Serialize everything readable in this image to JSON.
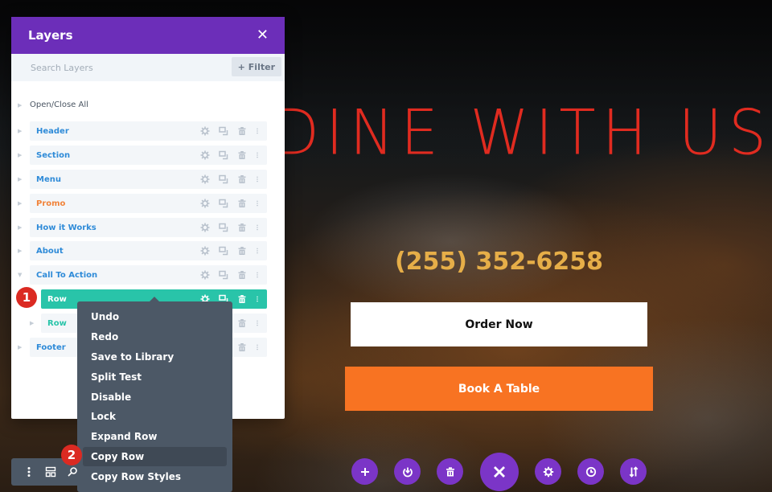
{
  "layers_panel": {
    "title": "Layers",
    "search_placeholder": "Search Layers",
    "filter_label": "Filter",
    "open_close_all": "Open/Close All",
    "items": [
      {
        "label": "Header",
        "color": "#2f8bd8",
        "expanded": false
      },
      {
        "label": "Section",
        "color": "#2f8bd8",
        "expanded": false
      },
      {
        "label": "Menu",
        "color": "#2f8bd8",
        "expanded": false
      },
      {
        "label": "Promo",
        "color": "#f1833a",
        "expanded": false
      },
      {
        "label": "How it Works",
        "color": "#2f8bd8",
        "expanded": false
      },
      {
        "label": "About",
        "color": "#2f8bd8",
        "expanded": false
      },
      {
        "label": "Call To Action",
        "color": "#2f8bd8",
        "expanded": true
      },
      {
        "label": "Row",
        "color": "#29c4a9",
        "active": true
      },
      {
        "label": "Row",
        "color": "#29c4a9",
        "expanded": false
      },
      {
        "label": "Footer",
        "color": "#2f8bd8",
        "expanded": false
      }
    ]
  },
  "context_menu": {
    "items": [
      {
        "label": "Undo"
      },
      {
        "label": "Redo"
      },
      {
        "label": "Save to Library"
      },
      {
        "label": "Split Test"
      },
      {
        "label": "Disable"
      },
      {
        "label": "Lock"
      },
      {
        "label": "Expand Row"
      },
      {
        "label": "Copy Row",
        "hovered": true
      },
      {
        "label": "Copy Row Styles"
      }
    ]
  },
  "badges": {
    "step1": "1",
    "step2": "2"
  },
  "hero": {
    "title": "DINE WITH US",
    "phone": "(255) 352-6258",
    "order_button": "Order Now",
    "book_button": "Book A Table"
  },
  "colors": {
    "panel_header": "#6c2eb9",
    "active_row": "#29c4a9",
    "toolbar_purple": "#7b35c7",
    "title_red": "#e02b20",
    "phone_gold": "#e6ae48",
    "book_orange": "#f87322",
    "badge_red": "#db2a22"
  }
}
